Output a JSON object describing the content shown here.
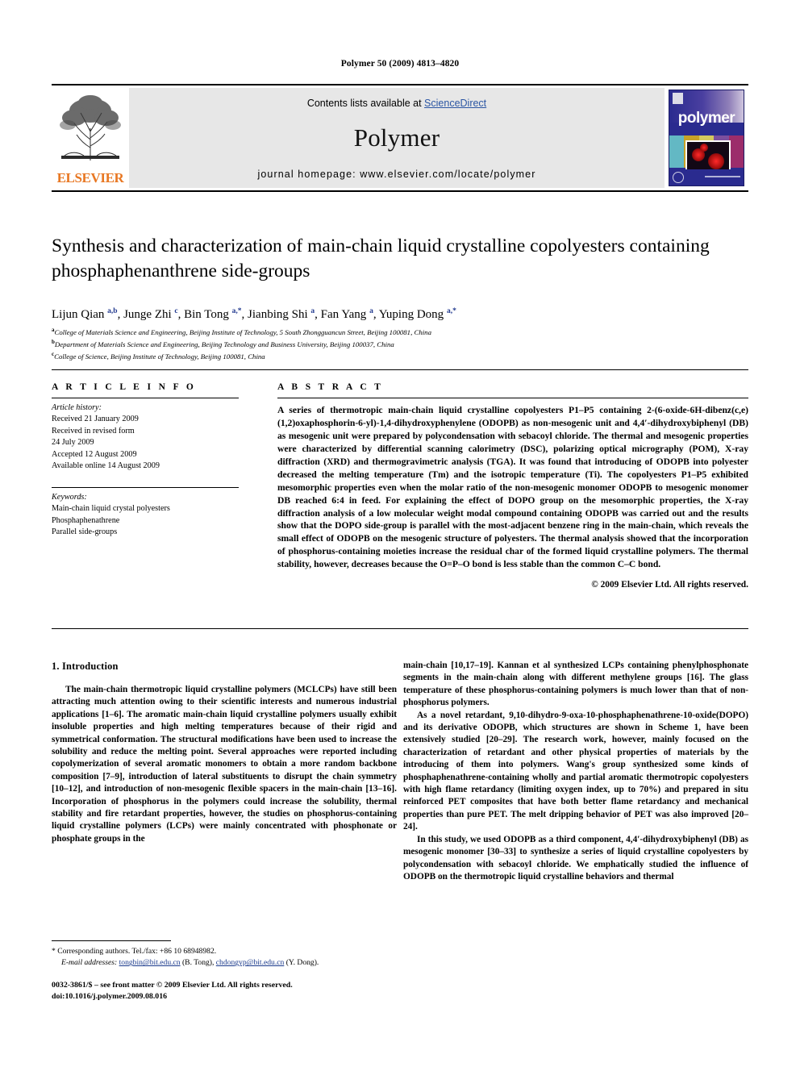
{
  "running_head": "Polymer 50 (2009) 4813–4820",
  "masthead": {
    "publisher": "ELSEVIER",
    "contents_prefix": "Contents lists available at ",
    "contents_link": "ScienceDirect",
    "journal_title": "Polymer",
    "homepage": "journal homepage: www.elsevier.com/locate/polymer",
    "cover_word": "polymer"
  },
  "article": {
    "title": "Synthesis and characterization of main-chain liquid crystalline copolyesters containing phosphaphenanthrene side-groups",
    "authors_html": "Lijun Qian <sup>a,b</sup>, Junge Zhi <sup>c</sup>, Bin Tong <sup>a,*</sup>, Jianbing Shi <sup>a</sup>, Fan Yang <sup>a</sup>, Yuping Dong <sup>a,*</sup>",
    "affiliations": [
      "College of Materials Science and Engineering, Beijing Institute of Technology, 5 South Zhongguancun Street, Beijing 100081, China",
      "Department of Materials Science and Engineering, Beijing Technology and Business University, Beijing 100037, China",
      "College of Science, Beijing Institute of Technology, Beijing 100081, China"
    ],
    "affiliation_marks": [
      "a",
      "b",
      "c"
    ]
  },
  "info": {
    "heading": "A R T I C L E   I N F O",
    "history_label": "Article history:",
    "history_lines": [
      "Received 21 January 2009",
      "Received in revised form",
      "24 July 2009",
      "Accepted 12 August 2009",
      "Available online 14 August 2009"
    ],
    "keywords_label": "Keywords:",
    "keywords": [
      "Main-chain liquid crystal polyesters",
      "Phosphaphenathrene",
      "Parallel side-groups"
    ]
  },
  "abstract": {
    "heading": "A B S T R A C T",
    "text": "A series of thermotropic main-chain liquid crystalline copolyesters P1–P5 containing 2-(6-oxide-6H-dibenz(c,e)(1,2)oxaphosphorin-6-yl)-1,4-dihydroxyphenylene (ODOPB) as non-mesogenic unit and 4,4′-dihydroxybiphenyl (DB) as mesogenic unit were prepared by polycondensation with sebacoyl chloride. The thermal and mesogenic properties were characterized by differential scanning calorimetry (DSC), polarizing optical micrography (POM), X-ray diffraction (XRD) and thermogravimetric analysis (TGA). It was found that introducing of ODOPB into polyester decreased the melting temperature (Tm) and the isotropic temperature (Ti). The copolyesters P1–P5 exhibited mesomorphic properties even when the molar ratio of the non-mesogenic monomer ODOPB to mesogenic monomer DB reached 6:4 in feed. For explaining the effect of DOPO group on the mesomorphic properties, the X-ray diffraction analysis of a low molecular weight modal compound containing ODOPB was carried out and the results show that the DOPO side-group is parallel with the most-adjacent benzene ring in the main-chain, which reveals the small effect of ODOPB on the mesogenic structure of polyesters. The thermal analysis showed that the incorporation of phosphorus-containing moieties increase the residual char of the formed liquid crystalline polymers. The thermal stability, however, decreases because the O=P–O bond is less stable than the common C–C bond.",
    "copyright": "© 2009 Elsevier Ltd. All rights reserved."
  },
  "body": {
    "section_number_title": "1.  Introduction",
    "left_paragraphs": [
      "The main-chain thermotropic liquid crystalline polymers (MCLCPs) have still been attracting much attention owing to their scientific interests and numerous industrial applications [1–6]. The aromatic main-chain liquid crystalline polymers usually exhibit insoluble properties and high melting temperatures because of their rigid and symmetrical conformation. The structural modifications have been used to increase the solubility and reduce the melting point. Several approaches were reported including copolymerization of several aromatic monomers to obtain a more random backbone composition [7–9], introduction of lateral substituents to disrupt the chain symmetry [10–12], and introduction of non-mesogenic flexible spacers in the main-chain [13–16]. Incorporation of phosphorus in the polymers could increase the solubility, thermal stability and fire retardant properties, however, the studies on phosphorus-containing liquid crystalline polymers (LCPs) were mainly concentrated with phosphonate or phosphate groups in the"
    ],
    "right_paragraphs": [
      "main-chain [10,17–19]. Kannan et al synthesized LCPs containing phenylphosphonate segments in the main-chain along with different methylene groups [16]. The glass temperature of these phosphorus-containing polymers is much lower than that of non-phosphorus polymers.",
      "As a novel retardant, 9,10-dihydro-9-oxa-10-phosphaphenathrene-10-oxide(DOPO) and its derivative ODOPB, which structures are shown in Scheme 1, have been extensively studied [20–29]. The research work, however, mainly focused on the characterization of retardant and other physical properties of materials by the introducing of them into polymers. Wang's group synthesized some kinds of phosphaphenathrene-containing wholly and partial aromatic thermotropic copolyesters with high flame retardancy (limiting oxygen index, up to 70%) and prepared in situ reinforced PET composites that have both better flame retardancy and mechanical properties than pure PET. The melt dripping behavior of PET was also improved [20–24].",
      "In this study, we used ODOPB as a third component, 4,4′-dihydroxybiphenyl (DB) as mesogenic monomer [30–33] to synthesize a series of liquid crystalline copolyesters by polycondensation with sebacoyl chloride. We emphatically studied the influence of ODOPB on the thermotropic liquid crystalline behaviors and thermal"
    ]
  },
  "footnote": {
    "corresponding": "* Corresponding authors. Tel./fax: +86 10 68948982.",
    "email_label": "E-mail addresses:",
    "email1": "tongbin@bit.edu.cn",
    "email1_owner": " (B. Tong), ",
    "email2": "chdongyp@bit.edu.cn",
    "email2_owner": " (Y. Dong)."
  },
  "imprint": {
    "issn_line": "0032-3861/$ – see front matter © 2009 Elsevier Ltd. All rights reserved.",
    "doi_line": "doi:10.1016/j.polymer.2009.08.016"
  },
  "colors": {
    "link_blue": "#2b55a3",
    "reference_blue": "#1b3a8c",
    "elsevier_orange": "#e87722",
    "cover_navy": "#2a2b8f",
    "banner_grey": "#e7e7e7"
  }
}
